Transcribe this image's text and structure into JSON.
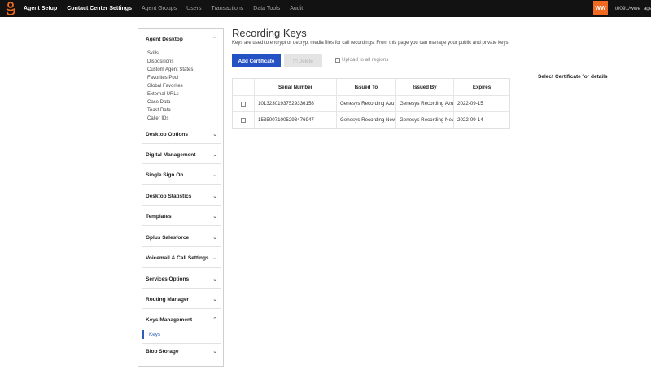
{
  "topbar": {
    "logo_icon": "genesys-logo-icon",
    "brand_color": "#f26a21",
    "nav": [
      {
        "label": "Agent Setup",
        "active": true
      },
      {
        "label": "Contact Center Settings",
        "active": true
      },
      {
        "label": "Agent Groups",
        "active": false
      },
      {
        "label": "Users",
        "active": false
      },
      {
        "label": "Transactions",
        "active": false
      },
      {
        "label": "Data Tools",
        "active": false
      },
      {
        "label": "Audit",
        "active": false
      }
    ],
    "avatar": "WW",
    "user": "t0091/wwe_age"
  },
  "sidebar": {
    "agent_desktop": {
      "title": "Agent Desktop",
      "items": [
        "Skills",
        "Dispositions",
        "Custom Agent States",
        "Favorites Pool",
        "Global Favorites",
        "External URLs",
        "Case Data",
        "Toast Data",
        "Caller IDs"
      ]
    },
    "sections": [
      "Desktop Options",
      "Digital Management",
      "Single Sign On",
      "Desktop Statistics",
      "Templates",
      "Gplus Salesforce",
      "Voicemail & Call Settings",
      "Services Options",
      "Routing Manager"
    ],
    "keys_management": {
      "title": "Keys Management",
      "active_item": "Keys"
    },
    "blob_storage": "Blob Storage"
  },
  "main": {
    "title": "Recording Keys",
    "description": "Keys are used to encrypt or decrypt media files for call recordings. From this page you can manage your public and private keys.",
    "add_button": "Add Certificate",
    "delete_button": "Delete",
    "upload_label": "Upload to all regions",
    "details_hint": "Select Certificate for details",
    "table": {
      "columns": [
        "Serial Number",
        "Issued To",
        "Issued By",
        "Expires"
      ],
      "rows": [
        {
          "serial": "10132301937529336158",
          "issued_to": "Genesys Recording Azu",
          "issued_by": "Genesys Recording Azu",
          "expires": "2022-09-15"
        },
        {
          "serial": "15350071005293476947",
          "issued_to": "Genesys Recording New",
          "issued_by": "Genesys Recording New",
          "expires": "2022-09-14"
        }
      ]
    }
  }
}
